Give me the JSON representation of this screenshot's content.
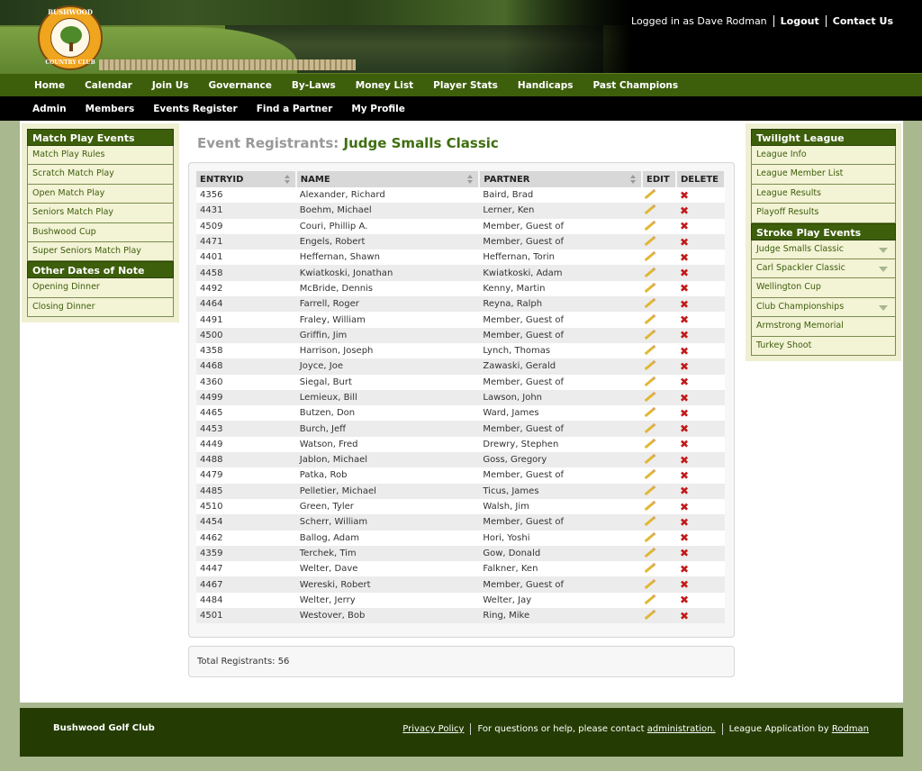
{
  "header": {
    "logo_top": "BUSHWOOD",
    "logo_bottom": "COUNTRY CLUB",
    "logged_in": "Logged in as Dave Rodman",
    "logout": "Logout",
    "contact": "Contact Us"
  },
  "nav_primary": [
    "Home",
    "Calendar",
    "Join Us",
    "Governance",
    "By-Laws",
    "Money List",
    "Player Stats",
    "Handicaps",
    "Past Champions"
  ],
  "nav_secondary": [
    "Admin",
    "Members",
    "Events Register",
    "Find a Partner",
    "My Profile"
  ],
  "left_sidebar": {
    "section1_title": "Match Play Events",
    "section1_items": [
      "Match Play Rules",
      "Scratch Match Play",
      "Open Match Play",
      "Seniors Match Play",
      "Bushwood Cup",
      "Super Seniors Match Play"
    ],
    "section2_title": "Other Dates of Note",
    "section2_items": [
      "Opening Dinner",
      "Closing Dinner"
    ]
  },
  "right_sidebar": {
    "section1_title": "Twilight League",
    "section1_items": [
      "League Info",
      "League Member List",
      "League Results",
      "Playoff Results"
    ],
    "section2_title": "Stroke Play Events",
    "section2_items": [
      "Judge Smalls Classic",
      "Carl Spackler Classic",
      "Wellington Cup",
      "Club Championships",
      "Armstrong Memorial",
      "Turkey Shoot"
    ]
  },
  "page": {
    "title_label": "Event Registrants: ",
    "event_name": "Judge Smalls Classic"
  },
  "table": {
    "columns": [
      "ENTRYID",
      "NAME",
      "PARTNER",
      "EDIT",
      "DELETE"
    ],
    "rows": [
      [
        "4356",
        "Alexander, Richard",
        "Baird, Brad"
      ],
      [
        "4431",
        "Boehm, Michael",
        "Lerner, Ken"
      ],
      [
        "4509",
        "Couri, Phillip A.",
        "Member, Guest of"
      ],
      [
        "4471",
        "Engels, Robert",
        "Member, Guest of"
      ],
      [
        "4401",
        "Heffernan, Shawn",
        "Heffernan, Torin"
      ],
      [
        "4458",
        "Kwiatkoski, Jonathan",
        "Kwiatkoski, Adam"
      ],
      [
        "4492",
        "McBride, Dennis",
        "Kenny, Martin"
      ],
      [
        "4464",
        "Farrell, Roger",
        "Reyna, Ralph"
      ],
      [
        "4491",
        "Fraley, William",
        "Member, Guest of"
      ],
      [
        "4500",
        "Griffin, Jim",
        "Member, Guest of"
      ],
      [
        "4358",
        "Harrison, Joseph",
        "Lynch, Thomas"
      ],
      [
        "4468",
        "Joyce, Joe",
        "Zawaski, Gerald"
      ],
      [
        "4360",
        "Siegal, Burt",
        "Member, Guest of"
      ],
      [
        "4499",
        "Lemieux, Bill",
        "Lawson, John"
      ],
      [
        "4465",
        "Butzen, Don",
        "Ward, James"
      ],
      [
        "4453",
        "Burch, Jeff",
        "Member, Guest of"
      ],
      [
        "4449",
        "Watson, Fred",
        "Drewry, Stephen"
      ],
      [
        "4488",
        "Jablon, Michael",
        "Goss, Gregory"
      ],
      [
        "4479",
        "Patka, Rob",
        "Member, Guest of"
      ],
      [
        "4485",
        "Pelletier, Michael",
        "Ticus, James"
      ],
      [
        "4510",
        "Green, Tyler",
        "Walsh, Jim"
      ],
      [
        "4454",
        "Scherr, William",
        "Member, Guest of"
      ],
      [
        "4462",
        "Ballog, Adam",
        "Hori, Yoshi"
      ],
      [
        "4359",
        "Terchek, Tim",
        "Gow, Donald"
      ],
      [
        "4447",
        "Welter, Dave",
        "Falkner, Ken"
      ],
      [
        "4467",
        "Wereski, Robert",
        "Member, Guest of"
      ],
      [
        "4484",
        "Welter, Jerry",
        "Welter, Jay"
      ],
      [
        "4501",
        "Westover, Bob",
        "Ring, Mike"
      ]
    ],
    "edit_icon": "pencil-icon",
    "delete_icon": "x-icon",
    "delete_glyph": "✖"
  },
  "total": "Total Registrants: 56",
  "footer": {
    "club": "Bushwood Golf Club",
    "privacy": "Privacy Policy",
    "help_text": "For questions or help, please contact ",
    "admin_link": "administration.",
    "app_text": "League Application by ",
    "app_link": "Rodman"
  },
  "colors": {
    "nav_green": "#3d5e0b",
    "footer_green": "#243c03",
    "page_bg": "#a9b88e",
    "delete_red": "#c01a1a",
    "title_green": "#3f6f10"
  }
}
